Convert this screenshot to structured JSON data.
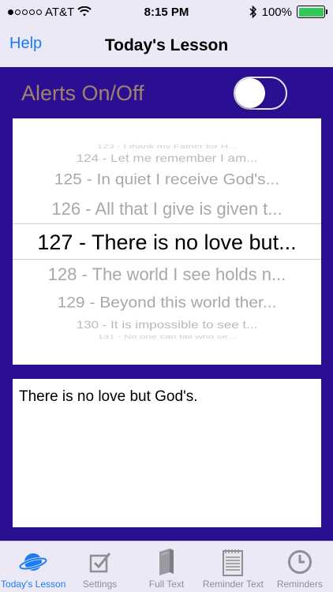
{
  "status_bar": {
    "carrier": "AT&T",
    "time": "8:15 PM",
    "battery": "100%"
  },
  "nav": {
    "help_label": "Help",
    "title": "Today's Lesson"
  },
  "alerts": {
    "label": "Alerts On/Off",
    "enabled": false
  },
  "picker": {
    "rows": [
      "123 - I thank my Father for H...",
      "124 - Let me remember I am...",
      "125 - In quiet I receive God's...",
      "126 - All that I give is given t...",
      "127 - There is no love but...",
      "128 - The world I see holds n...",
      "129 - Beyond this world ther...",
      "130 - It is impossible to see t...",
      "131 - No one can fail who se..."
    ],
    "selected": "127 - There is no love but..."
  },
  "lesson_text": "There is no love but God's.",
  "tabs": [
    {
      "label": "Today's Lesson",
      "icon": "planet-icon",
      "active": true
    },
    {
      "label": "Settings",
      "icon": "checkbox-icon",
      "active": false
    },
    {
      "label": "Full Text",
      "icon": "book-icon",
      "active": false
    },
    {
      "label": "Reminder Text",
      "icon": "notepad-icon",
      "active": false
    },
    {
      "label": "Reminders",
      "icon": "clock-icon",
      "active": false
    }
  ],
  "colors": {
    "accent": "#1a7cf5",
    "background": "#2a0f93",
    "bars": "#ece9f6",
    "alerts_label": "#a0836a",
    "battery": "#34c759"
  }
}
